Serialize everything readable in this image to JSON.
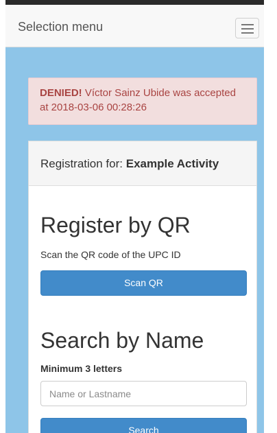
{
  "navbar": {
    "brand": "Selection menu",
    "toggle_icon": "hamburger-menu-icon"
  },
  "alert": {
    "status": "DENIED!",
    "message": " Víctor Sainz Ubide was accepted at 2018-03-06 00:28:26"
  },
  "panel": {
    "heading_prefix": "Registration for: ",
    "activity_name": "Example Activity",
    "qr_section": {
      "title": "Register by QR",
      "hint": "Scan the QR code of the UPC ID",
      "button_label": "Scan QR"
    },
    "name_section": {
      "title": "Search by Name",
      "label": "Minimum 3 letters",
      "input_value": "",
      "input_placeholder": "Name or Lastname",
      "button_label": "Search"
    }
  },
  "colors": {
    "page_background": "#8ec5e8",
    "primary_button": "#428bca",
    "alert_background": "#f2dede",
    "alert_text": "#a94442"
  }
}
